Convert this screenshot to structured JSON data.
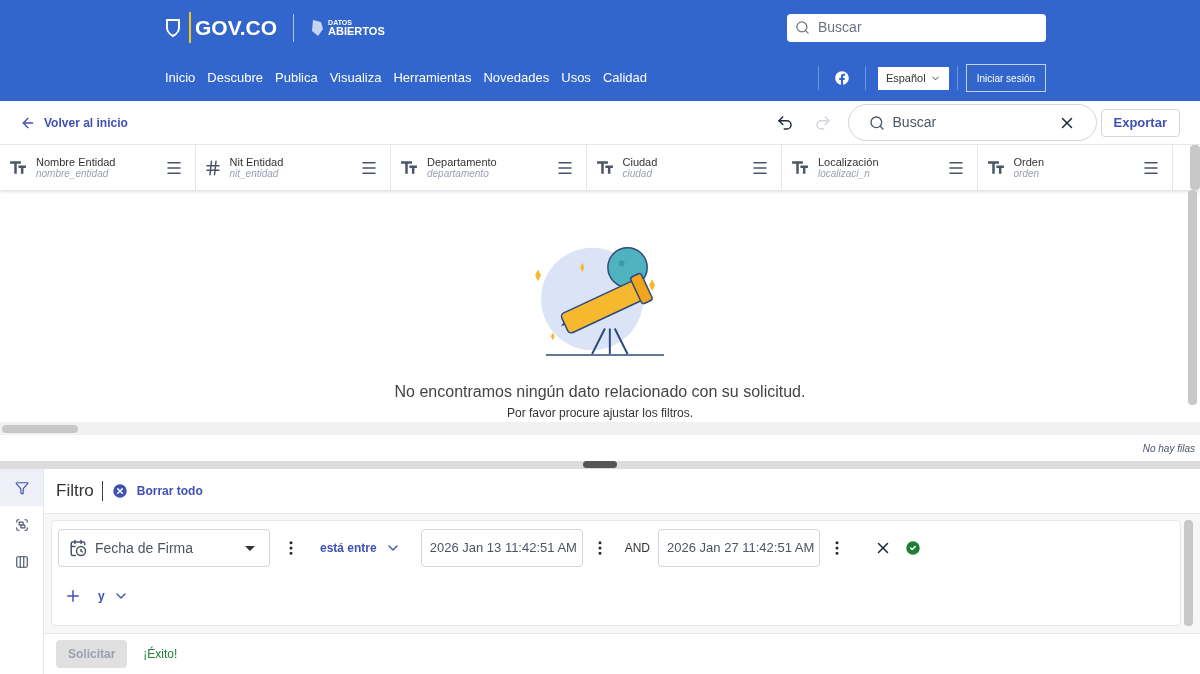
{
  "header": {
    "logo": "GOV.CO",
    "brand_top": "DATOS",
    "brand_bottom": "ABIERTOS",
    "search": {
      "placeholder": "Buscar"
    },
    "nav": [
      "Inicio",
      "Descubre",
      "Publica",
      "Visualiza",
      "Herramientas",
      "Novedades",
      "Usos",
      "Calidad"
    ],
    "language": "Español",
    "login": "Iniciar sesión"
  },
  "toolbar": {
    "back": "Volver al inicio",
    "undo": {
      "disabled": false
    },
    "redo": {
      "disabled": true
    },
    "search": {
      "placeholder": "Buscar"
    },
    "export": "Exportar"
  },
  "table": {
    "columns": [
      {
        "kind": "text",
        "name": "Nombre Entidad",
        "field": "nombre_entidad"
      },
      {
        "kind": "number",
        "name": "Nit Entidad",
        "field": "nit_entidad"
      },
      {
        "kind": "text",
        "name": "Departamento",
        "field": "departamento"
      },
      {
        "kind": "text",
        "name": "Ciudad",
        "field": "ciudad"
      },
      {
        "kind": "text",
        "name": "Localización",
        "field": "localizaci_n"
      },
      {
        "kind": "text",
        "name": "Orden",
        "field": "orden"
      }
    ],
    "empty_title": "No encontramos ningún dato relacionado con su solicitud.",
    "empty_hint": "Por favor procure ajustar los filtros.",
    "row_count": "No hay filas"
  },
  "side_tabs": [
    {
      "kind": "filter",
      "selected": true
    },
    {
      "kind": "group",
      "selected": false
    },
    {
      "kind": "columns",
      "selected": false
    }
  ],
  "filter": {
    "title": "Filtro",
    "clear": "Borrar todo",
    "field": "Fecha de Firma",
    "operator": "está entre",
    "from": "2026 Jan 13 11:42:51 AM",
    "joiner": "AND",
    "to": "2026 Jan 27 11:42:51 AM",
    "add_conjunction": "y",
    "valid": true
  },
  "submit": {
    "label": "Solicitar",
    "disabled": true
  },
  "status": "¡Éxito!"
}
